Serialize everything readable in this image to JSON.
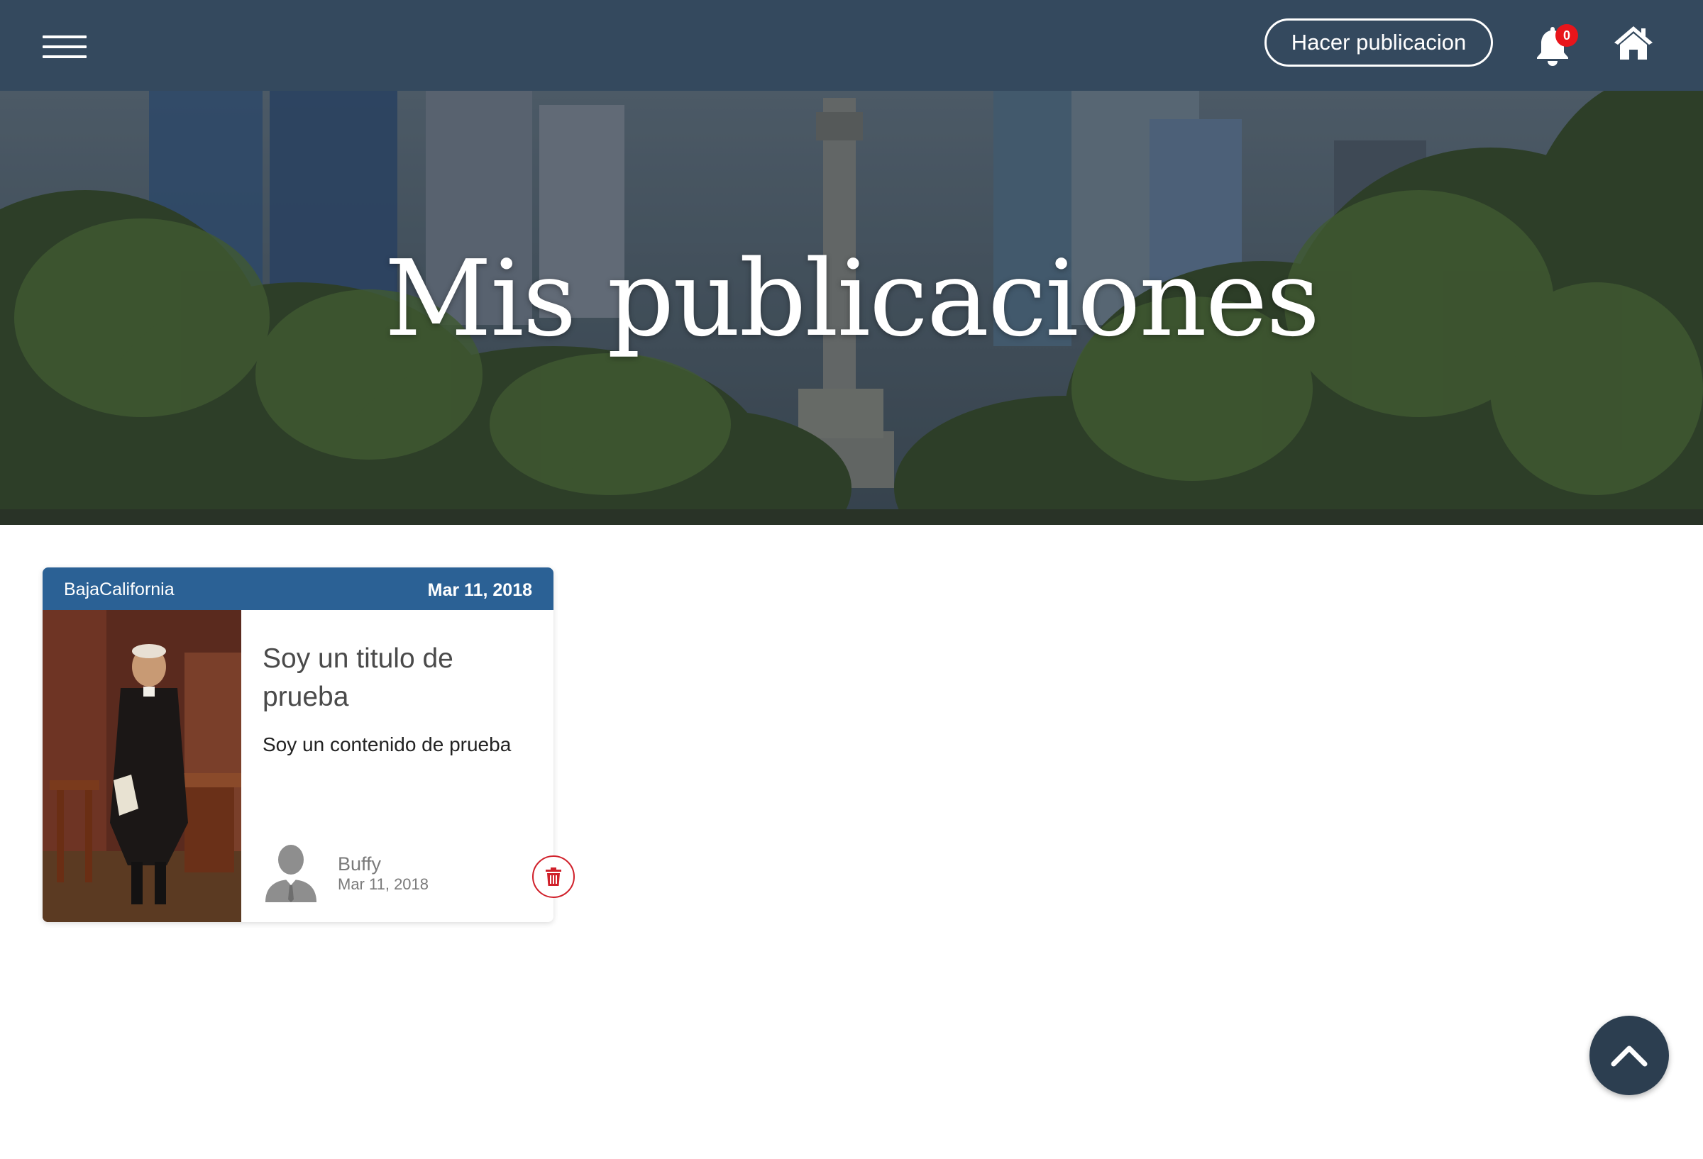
{
  "navbar": {
    "menu_icon": "hamburger-menu-icon",
    "publish_label": "Hacer publicacion",
    "notification_icon": "bell-icon",
    "notification_count": "0",
    "home_icon": "home-icon"
  },
  "hero": {
    "title": "Mis publicaciones"
  },
  "posts": [
    {
      "region": "BajaCalifornia",
      "date": "Mar 11, 2018",
      "title": "Soy un titulo de prueba",
      "content": "Soy un contenido de prueba",
      "author": "Buffy",
      "author_date": "Mar 11, 2018",
      "delete_icon": "trash-icon"
    }
  ],
  "scroll_top_icon": "chevron-up-icon",
  "colors": {
    "navbar": "#34495e",
    "card_header": "#2b6195",
    "badge": "#e8151b",
    "delete": "#d0202a",
    "scroll_top": "#2c3e50"
  }
}
